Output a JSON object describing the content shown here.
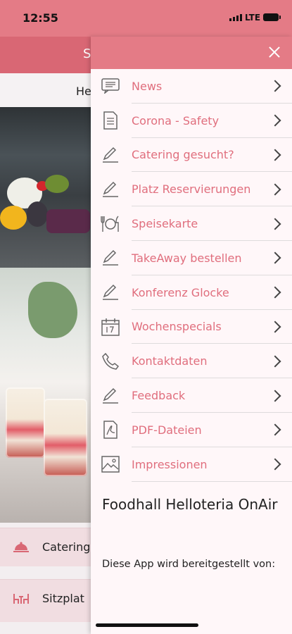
{
  "status": {
    "time": "12:55",
    "network": "LTE"
  },
  "background": {
    "header_title": "S",
    "subheader": "He",
    "rows": [
      {
        "label": "Catering",
        "icon": "cloche-icon"
      },
      {
        "label": "Sitzplat",
        "icon": "seating-icon"
      }
    ]
  },
  "drawer": {
    "menu": [
      {
        "label": "News",
        "icon": "news-icon"
      },
      {
        "label": "Corona - Safety",
        "icon": "document-icon"
      },
      {
        "label": "Catering gesucht?",
        "icon": "edit-icon"
      },
      {
        "label": "Platz Reservierungen",
        "icon": "edit-icon"
      },
      {
        "label": "Speisekarte",
        "icon": "cutlery-icon"
      },
      {
        "label": "TakeAway bestellen",
        "icon": "edit-icon"
      },
      {
        "label": "Konferenz Glocke",
        "icon": "edit-icon"
      },
      {
        "label": "Wochenspecials",
        "icon": "calendar-icon"
      },
      {
        "label": "Kontaktdaten",
        "icon": "phone-icon"
      },
      {
        "label": "Feedback",
        "icon": "edit-icon"
      },
      {
        "label": "PDF-Dateien",
        "icon": "pdf-icon"
      },
      {
        "label": "Impressionen",
        "icon": "image-icon"
      }
    ],
    "footer_title": "Foodhall Helloteria OnAir",
    "footer_text": "Diese App wird bereitgestellt von:"
  },
  "colors": {
    "accent": "#e06e7d",
    "header": "#e47b86"
  }
}
